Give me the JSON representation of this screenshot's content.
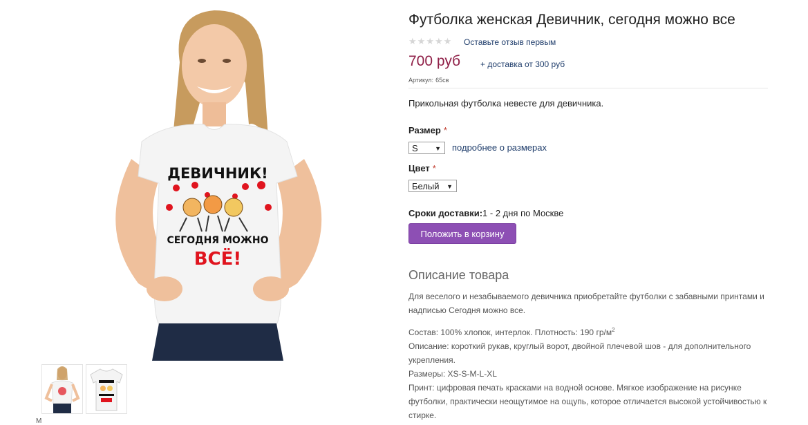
{
  "product": {
    "title": "Футболка женская Девичник, сегодня можно все",
    "review_link": "Оставьте отзыв первым",
    "rating_stars": 0,
    "price": "700 руб",
    "delivery_cost": "+ доставка от 300 руб",
    "sku_label": "Артикул:",
    "sku_value": "65св",
    "short_description": "Прикольная футболка невесте для девичника."
  },
  "options": {
    "size_label": "Размер",
    "size_required": "*",
    "size_value": "S",
    "size_link": "подробнее о размерах",
    "color_label": "Цвет",
    "color_required": "*",
    "color_value": "Белый"
  },
  "shipping": {
    "label": "Сроки доставки:",
    "value": "1 - 2 дня по Москве"
  },
  "cart_button": "Положить в корзину",
  "description": {
    "heading": "Описание товара",
    "intro": "Для веселого и незабываемого девичника приобретайте футболки с забавными принтами и надписью Сегодня можно все.",
    "composition": "Состав: 100% хлопок, интерлок. Плотность: 190 гр/м",
    "composition_sup": "2",
    "details": "Описание: короткий рукав, круглый ворот, двойной плечевой шов - для дополнительного укрепления.",
    "sizes": "Размеры: XS-S-M-L-XL",
    "print": "Принт: цифровая печать красками на водной основе. Мягкое изображение на рисунке футболки, практически неощутимое на ощупь, которое отличается высокой устойчивостью к стирке."
  },
  "print_text": {
    "line1": "ДЕВИЧНИК!",
    "line2": "СЕГОДНЯ МОЖНО",
    "line3": "ВСЁ!"
  },
  "colors": {
    "price": "#8f1f47",
    "button": "#8d4fb4",
    "link": "#1f3d6b",
    "print_red": "#e0141e"
  },
  "misc": {
    "cut_off_text": "М"
  }
}
